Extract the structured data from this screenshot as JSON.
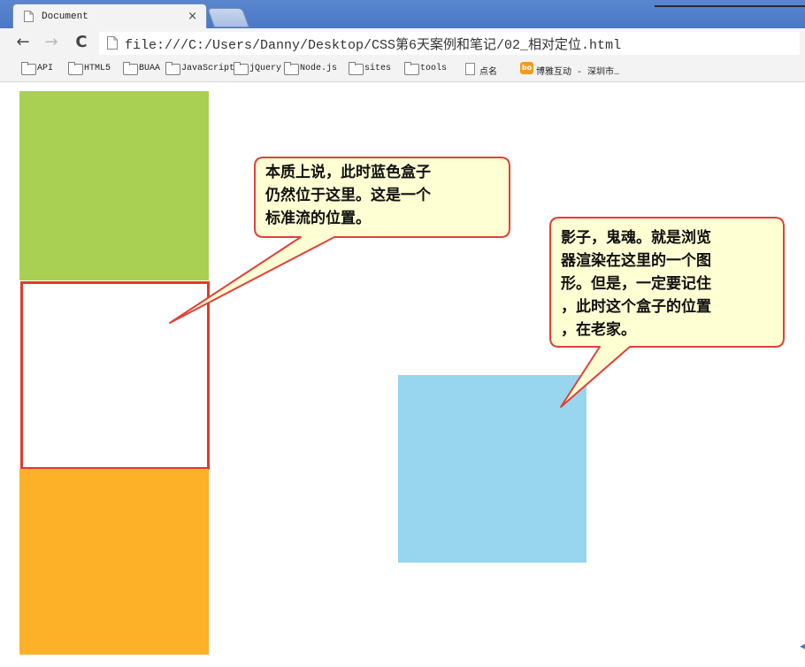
{
  "browser": {
    "tab_title": "Document",
    "tab_close": "×",
    "url": "file:///C:/Users/Danny/Desktop/CSS第6天案例和笔记/02_相对定位.html",
    "nav": {
      "back": "←",
      "forward": "→",
      "reload": "C"
    }
  },
  "bookmarks": [
    {
      "label": "API",
      "icon": "folder-icon"
    },
    {
      "label": "HTML5",
      "icon": "folder-icon"
    },
    {
      "label": "BUAA",
      "icon": "folder-icon"
    },
    {
      "label": "JavaScript",
      "icon": "folder-icon"
    },
    {
      "label": "jQuery",
      "icon": "folder-icon"
    },
    {
      "label": "Node.js",
      "icon": "folder-icon"
    },
    {
      "label": "sites",
      "icon": "folder-icon"
    },
    {
      "label": "tools",
      "icon": "folder-icon"
    },
    {
      "label": "点名",
      "icon": "page-icon"
    },
    {
      "label": "博雅互动 - 深圳市…",
      "icon": "bo-icon",
      "icon_text": "bo"
    }
  ],
  "page": {
    "colors": {
      "green": "#a9d052",
      "orange": "#fdb128",
      "blue": "#98d5ef",
      "outline": "#e23a2a",
      "callout_fill": "#ffffd4",
      "callout_border": "#e0403a"
    },
    "callout1": {
      "lines": [
        "本质上说，此时蓝色盒子",
        "仍然位于这里。这是一个",
        "标准流的位置。"
      ]
    },
    "callout2": {
      "lines": [
        "影子，鬼魂。就是浏览",
        "器渲染在这里的一个图",
        "形。但是，一定要记住",
        "，此时这个盒子的位置",
        "，在老家。"
      ]
    }
  }
}
